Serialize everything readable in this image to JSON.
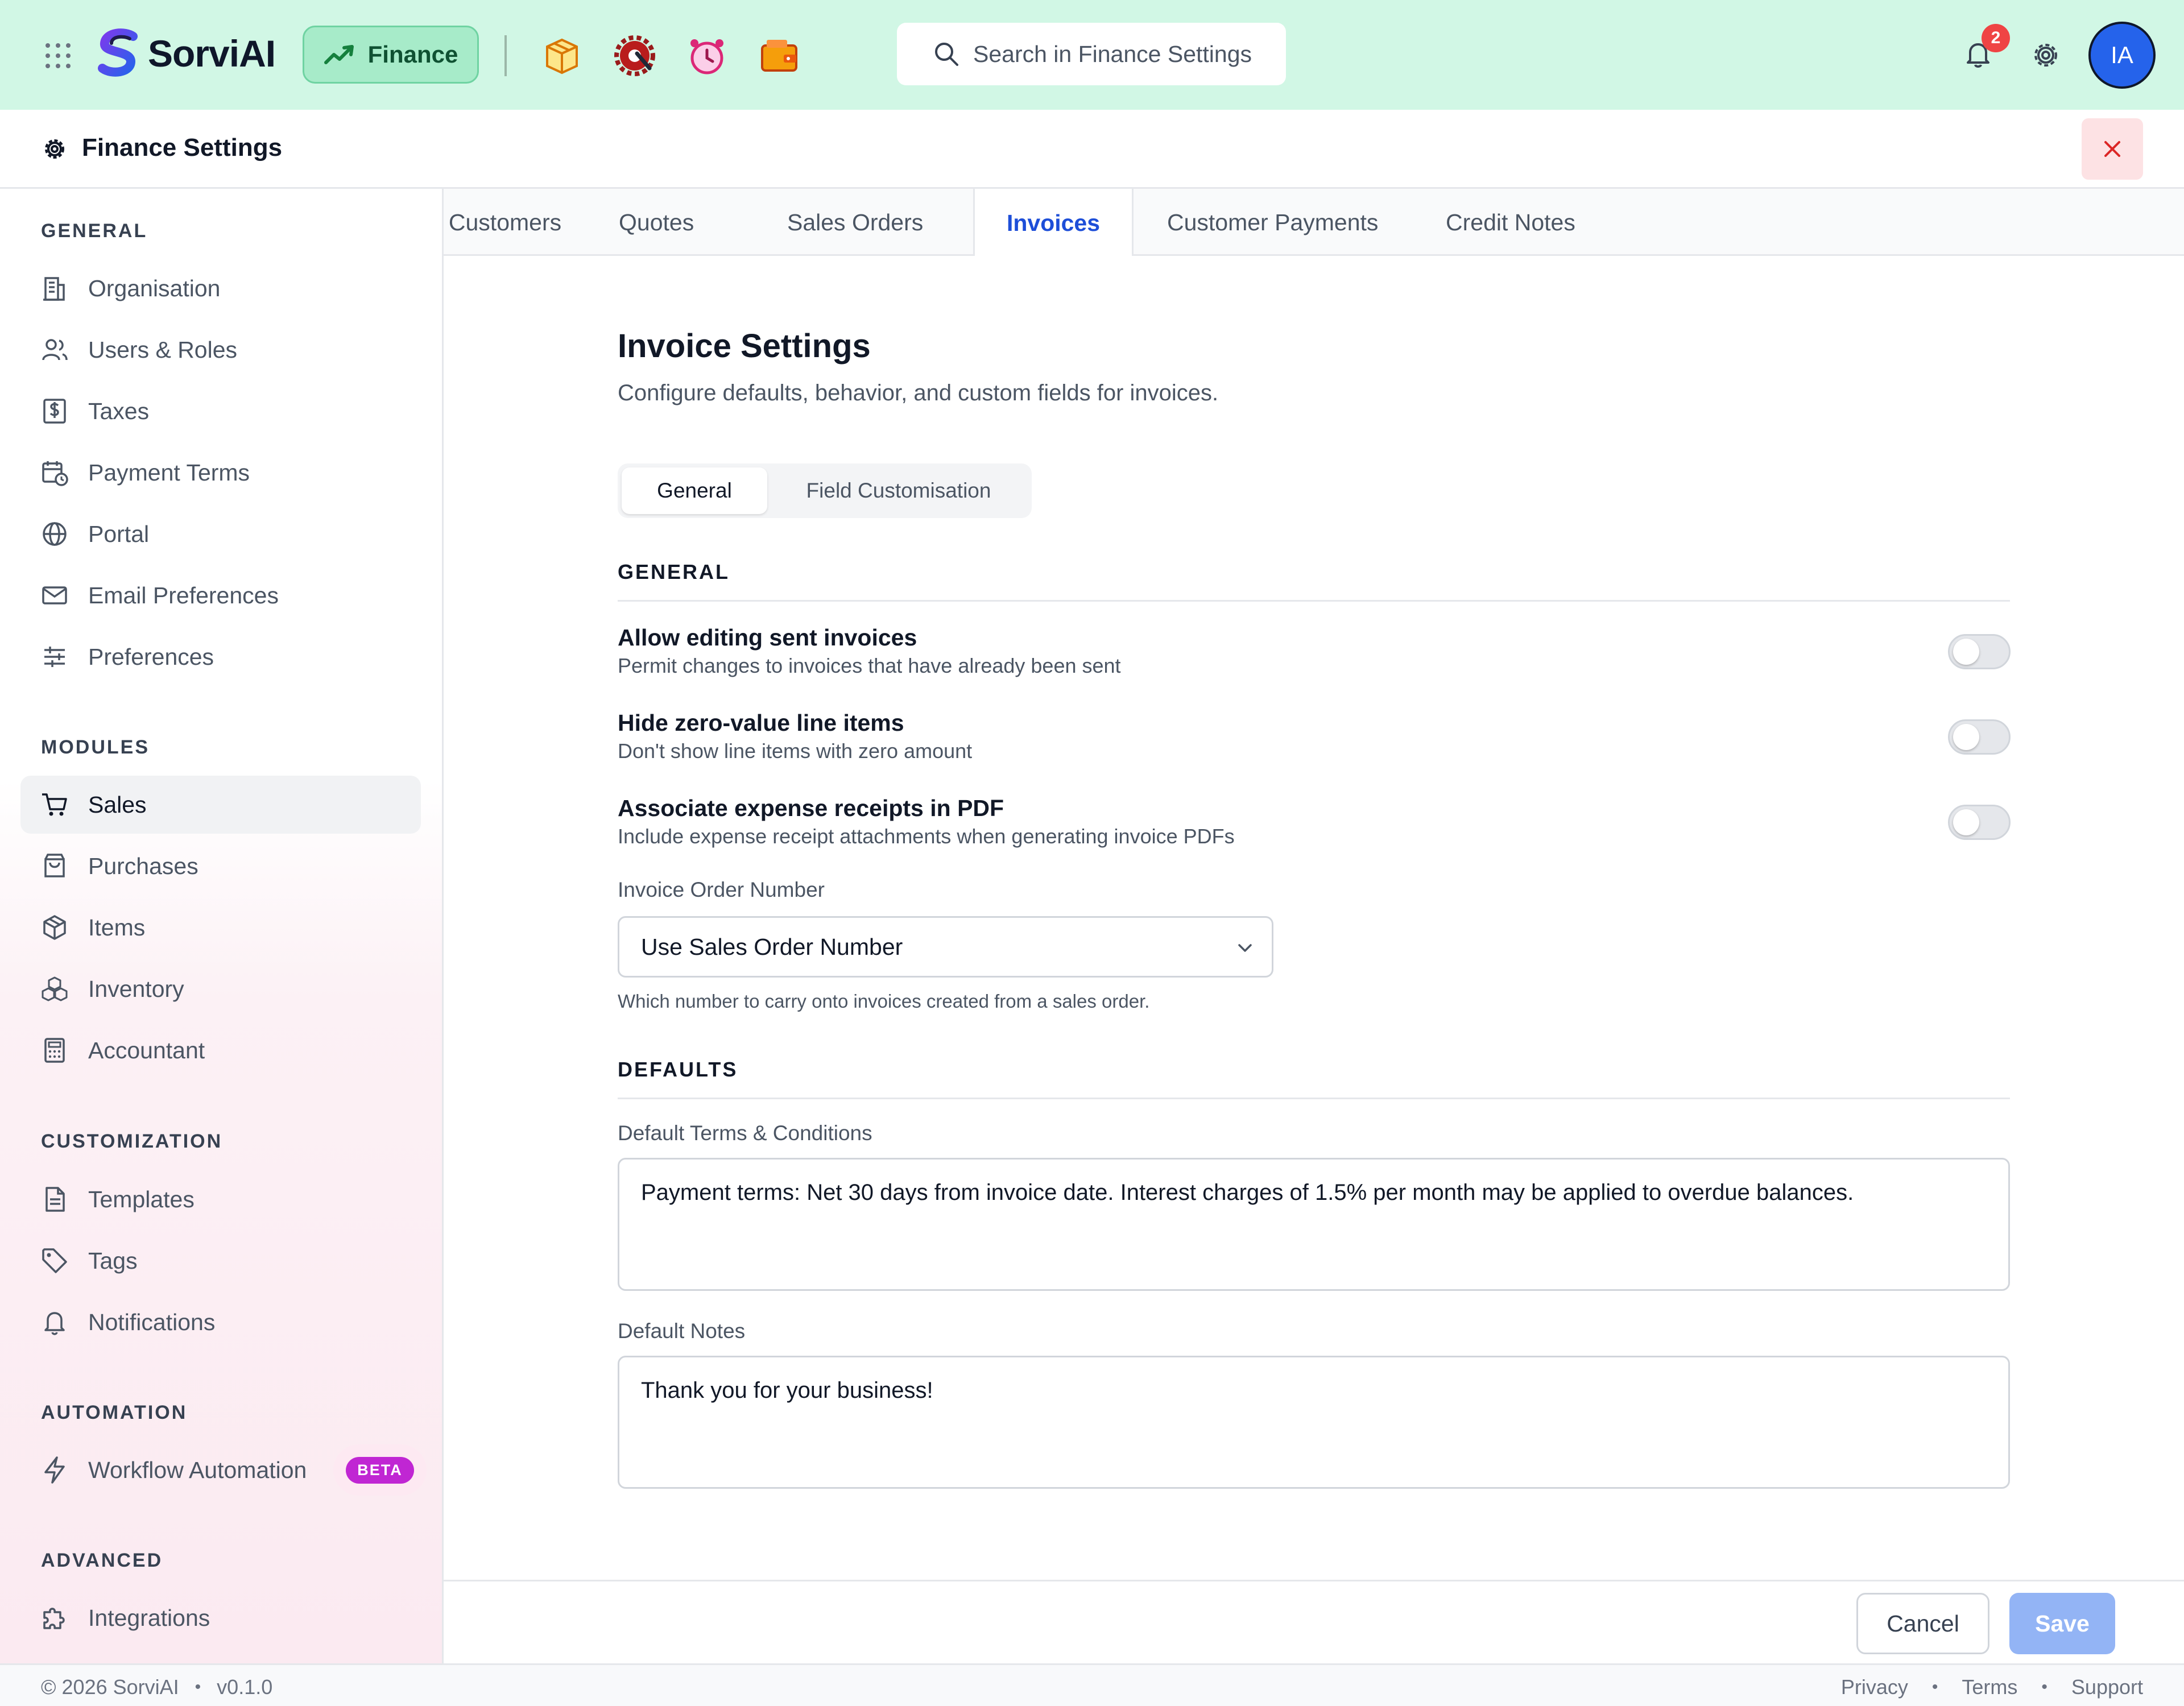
{
  "app": {
    "brand": "SorviAI",
    "module_label": "Finance",
    "search_placeholder": "Search in Finance Settings",
    "notification_count": "2",
    "avatar_initials": "IA",
    "apps": [
      "shopping-box-icon",
      "settings-wrench-icon",
      "alarm-clock-icon",
      "wallet-icon"
    ]
  },
  "settings": {
    "title": "Finance Settings"
  },
  "sidebar": {
    "sections": {
      "general": "GENERAL",
      "modules": "MODULES",
      "customization": "CUSTOMIZATION",
      "automation": "AUTOMATION",
      "advanced": "ADVANCED"
    },
    "general_items": [
      {
        "label": "Organisation",
        "icon": "building-icon"
      },
      {
        "label": "Users & Roles",
        "icon": "users-icon"
      },
      {
        "label": "Taxes",
        "icon": "dollar-file-icon"
      },
      {
        "label": "Payment Terms",
        "icon": "calendar-clock-icon"
      },
      {
        "label": "Portal",
        "icon": "globe-icon"
      },
      {
        "label": "Email Preferences",
        "icon": "mail-icon"
      },
      {
        "label": "Preferences",
        "icon": "sliders-icon"
      }
    ],
    "module_items": [
      {
        "label": "Sales",
        "icon": "cart-icon",
        "active": true
      },
      {
        "label": "Purchases",
        "icon": "shopping-bag-icon"
      },
      {
        "label": "Items",
        "icon": "package-icon"
      },
      {
        "label": "Inventory",
        "icon": "boxes-icon"
      },
      {
        "label": "Accountant",
        "icon": "calculator-icon"
      }
    ],
    "customization_items": [
      {
        "label": "Templates",
        "icon": "document-icon"
      },
      {
        "label": "Tags",
        "icon": "tag-icon"
      },
      {
        "label": "Notifications",
        "icon": "bell-icon"
      }
    ],
    "automation_items": [
      {
        "label": "Workflow Automation",
        "icon": "lightning-icon",
        "badge": "BETA"
      }
    ],
    "advanced_items": [
      {
        "label": "Integrations",
        "icon": "puzzle-icon"
      }
    ]
  },
  "tabs": [
    {
      "label": "Customers"
    },
    {
      "label": "Quotes"
    },
    {
      "label": "Sales Orders"
    },
    {
      "label": "Invoices",
      "active": true
    },
    {
      "label": "Customer Payments"
    },
    {
      "label": "Credit Notes"
    }
  ],
  "invoice": {
    "title": "Invoice Settings",
    "subtitle": "Configure defaults, behavior, and custom fields for invoices.",
    "segments": [
      {
        "label": "General",
        "active": true
      },
      {
        "label": "Field Customisation"
      }
    ],
    "general_heading": "GENERAL",
    "toggles": [
      {
        "title": "Allow editing sent invoices",
        "description": "Permit changes to invoices that have already been sent",
        "enabled": false
      },
      {
        "title": "Hide zero-value line items",
        "description": "Don't show line items with zero amount",
        "enabled": false
      },
      {
        "title": "Associate expense receipts in PDF",
        "description": "Include expense receipt attachments when generating invoice PDFs",
        "enabled": false
      }
    ],
    "order_number": {
      "label": "Invoice Order Number",
      "value": "Use Sales Order Number",
      "help": "Which number to carry onto invoices created from a sales order."
    },
    "defaults_heading": "DEFAULTS",
    "terms": {
      "label": "Default Terms & Conditions",
      "value": "Payment terms: Net 30 days from invoice date. Interest charges of 1.5% per month may be applied to overdue balances."
    },
    "notes": {
      "label": "Default Notes",
      "value": "Thank you for your business!"
    }
  },
  "actions": {
    "cancel": "Cancel",
    "save": "Save"
  },
  "footer": {
    "copyright": "© 2026 SorviAI",
    "version": "v0.1.0",
    "links": [
      "Privacy",
      "Terms",
      "Support"
    ]
  },
  "colors": {
    "topbar": "#d1f7e5",
    "accent": "#1d4ed8",
    "avatar": "#2563eb",
    "beta": "#c026d3",
    "save_disabled": "#93b4f5"
  }
}
